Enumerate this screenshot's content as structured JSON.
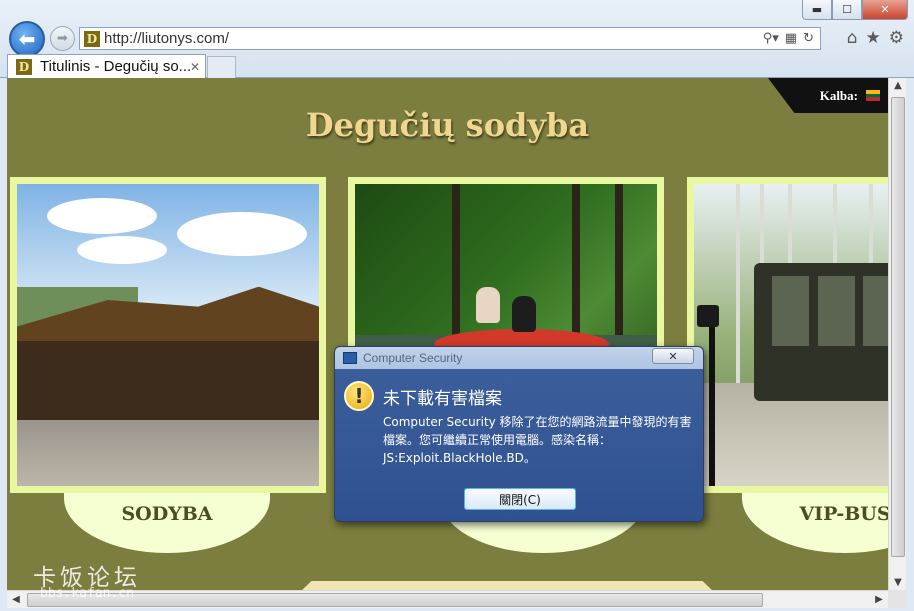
{
  "browser": {
    "url": "http://liutonys.com/",
    "tab_title": "Titulinis - Degučių so...",
    "favicon_letter": "D",
    "icons": [
      "back-icon",
      "forward-icon",
      "search-icon",
      "compat-icon",
      "refresh-icon",
      "home-icon",
      "favorites-star-icon",
      "tools-gear-icon"
    ],
    "window_buttons": {
      "minimize": "▬",
      "maximize": "☐",
      "close": "✕"
    }
  },
  "page": {
    "language_label": "Kalba:",
    "language_flag_colors": [
      "#fdb913",
      "#006a44",
      "#c1272d"
    ],
    "title": "Degučių sodyba",
    "cards": [
      {
        "label": "SODYBA"
      },
      {
        "label": ""
      },
      {
        "label": "VIP-BUS"
      }
    ],
    "colors": {
      "background": "#7b7e3f",
      "card_frame": "#e9f7a0",
      "title": "#f0d68f"
    }
  },
  "dialog": {
    "title": "Computer Security",
    "close_glyph": "✕",
    "heading": "未下載有害檔案",
    "message": "Computer Security 移除了在您的網路流量中發現的有害檔案。您可繼續正常使用電腦。感染名稱：JS:Exploit.BlackHole.BD。",
    "button_label": "關閉(C)",
    "warning_icon": "!"
  },
  "watermark": {
    "main": "卡饭论坛",
    "sub": "bbs.kafan.cn"
  }
}
